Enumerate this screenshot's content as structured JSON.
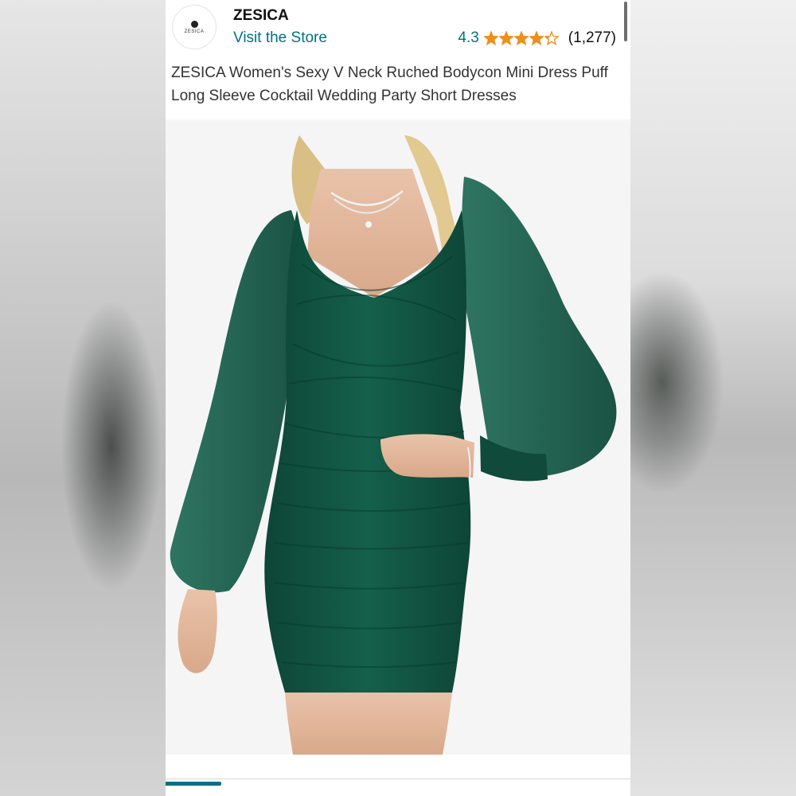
{
  "store": {
    "logo_text": "ZESICA",
    "name": "ZESICA",
    "visit_label": "Visit the Store"
  },
  "rating": {
    "value": "4.3",
    "stars": 4.3,
    "count": "(1,277)",
    "star_color": "#F08C1A"
  },
  "product": {
    "title": "ZESICA Women's Sexy V Neck Ruched Bodycon Mini Dress Puff Long Sleeve Cocktail Wedding Party Short Dresses",
    "image_subject": "dark-green-ruched-bodycon-dress",
    "dress_color": "#11503E"
  },
  "colors": {
    "link": "#007185",
    "text": "#0F1111"
  }
}
